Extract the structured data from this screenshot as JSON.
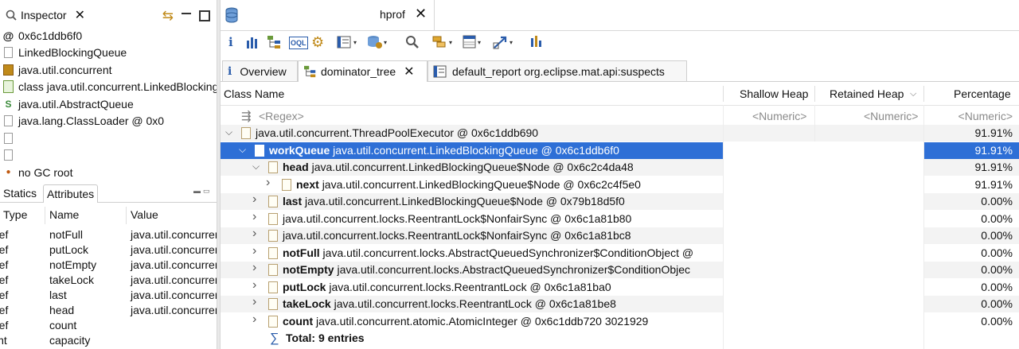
{
  "left_panel": {
    "tab_title": "Inspector",
    "lines": [
      {
        "icon": "at-sign-icon",
        "text": "0x6c1ddb6f0"
      },
      {
        "icon": "document-icon",
        "text": "LinkedBlockingQueue"
      },
      {
        "icon": "package-icon",
        "text": "java.util.concurrent"
      },
      {
        "icon": "class-icon",
        "text": "class java.util.concurrent.LinkedBlockingQueue"
      },
      {
        "icon": "superclass-icon",
        "text": "java.util.AbstractQueue"
      },
      {
        "icon": "classloader-icon",
        "text": "java.lang.ClassLoader @ 0x0"
      },
      {
        "icon": "document-icon",
        "text": ""
      },
      {
        "icon": "document-icon",
        "text": ""
      },
      {
        "icon": "gc-root-icon",
        "text": "no GC root"
      }
    ],
    "tabs": [
      "Statics",
      "Attributes"
    ],
    "attributes": {
      "headers": [
        "Type",
        "Name",
        "Value"
      ],
      "rows": [
        {
          "type": "ref",
          "name": "notFull",
          "value": "java.util.concurrent"
        },
        {
          "type": "ref",
          "name": "putLock",
          "value": "java.util.concurrent"
        },
        {
          "type": "ref",
          "name": "notEmpty",
          "value": "java.util.concurrent"
        },
        {
          "type": "ref",
          "name": "takeLock",
          "value": "java.util.concurrent"
        },
        {
          "type": "ref",
          "name": "last",
          "value": "java.util.concurrent"
        },
        {
          "type": "ref",
          "name": "head",
          "value": "java.util.concurrent"
        },
        {
          "type": "ref",
          "name": "count",
          "value": ""
        },
        {
          "type": "int",
          "name": "capacity",
          "value": ""
        }
      ]
    }
  },
  "editor": {
    "tab_title": "hprof",
    "toolbar_icons": [
      "info-icon",
      "histogram-icon",
      "dominator-tree-icon",
      "oql-icon",
      "thread-icon",
      "query-browser-icon",
      "heap-dump-overview-icon",
      "search-icon",
      "group-by-icon",
      "calculate-icon",
      "export-icon",
      "pie-chart-icon"
    ],
    "sub_tabs": [
      {
        "label": "Overview",
        "icon": "info-icon"
      },
      {
        "label": "dominator_tree",
        "icon": "dominator-tree-icon"
      },
      {
        "label": "default_report org.eclipse.mat.api:suspects",
        "icon": "report-icon"
      }
    ],
    "columns": [
      "Class Name",
      "Shallow Heap",
      "Retained Heap",
      "Percentage"
    ],
    "filter_row": {
      "class": "<Regex>",
      "shallow": "<Numeric>",
      "retained": "<Numeric>",
      "percentage": "<Numeric>"
    },
    "rows": [
      {
        "indent": 0,
        "twisty": "expanded",
        "bold": "",
        "text": "java.util.concurrent.ThreadPoolExecutor @ 0x6c1ddb690",
        "pct": "91.91%",
        "selected": false
      },
      {
        "indent": 1,
        "twisty": "expanded",
        "bold": "workQueue",
        "text": "java.util.concurrent.LinkedBlockingQueue @ 0x6c1ddb6f0",
        "pct": "91.91%",
        "selected": true
      },
      {
        "indent": 2,
        "twisty": "expanded",
        "bold": "head",
        "text": "java.util.concurrent.LinkedBlockingQueue$Node @ 0x6c2c4da48",
        "pct": "91.91%",
        "selected": false
      },
      {
        "indent": 3,
        "twisty": "collapsed",
        "bold": "next",
        "text": "java.util.concurrent.LinkedBlockingQueue$Node @ 0x6c2c4f5e0",
        "pct": "91.91%",
        "selected": false
      },
      {
        "indent": 2,
        "twisty": "collapsed",
        "bold": "last",
        "text": "java.util.concurrent.LinkedBlockingQueue$Node @ 0x79b18d5f0",
        "pct": "0.00%",
        "selected": false
      },
      {
        "indent": 2,
        "twisty": "collapsed",
        "bold": "",
        "text": "java.util.concurrent.locks.ReentrantLock$NonfairSync @ 0x6c1a81b80",
        "pct": "0.00%",
        "selected": false
      },
      {
        "indent": 2,
        "twisty": "collapsed",
        "bold": "",
        "text": "java.util.concurrent.locks.ReentrantLock$NonfairSync @ 0x6c1a81bc8",
        "pct": "0.00%",
        "selected": false
      },
      {
        "indent": 2,
        "twisty": "collapsed",
        "bold": "notFull",
        "text": "java.util.concurrent.locks.AbstractQueuedSynchronizer$ConditionObject @",
        "pct": "0.00%",
        "selected": false
      },
      {
        "indent": 2,
        "twisty": "collapsed",
        "bold": "notEmpty",
        "text": "java.util.concurrent.locks.AbstractQueuedSynchronizer$ConditionObjec",
        "pct": "0.00%",
        "selected": false
      },
      {
        "indent": 2,
        "twisty": "collapsed",
        "bold": "putLock",
        "text": "java.util.concurrent.locks.ReentrantLock @ 0x6c1a81ba0",
        "pct": "0.00%",
        "selected": false
      },
      {
        "indent": 2,
        "twisty": "collapsed",
        "bold": "takeLock",
        "text": "java.util.concurrent.locks.ReentrantLock @ 0x6c1a81be8",
        "pct": "0.00%",
        "selected": false
      },
      {
        "indent": 2,
        "twisty": "collapsed",
        "bold": "count",
        "text": "java.util.concurrent.atomic.AtomicInteger @ 0x6c1ddb720  3021929",
        "pct": "0.00%",
        "selected": false
      }
    ],
    "total_label": "Total: 9 entries"
  },
  "colors": {
    "selection": "#2e6fd6",
    "stripe": "#f3f3f3"
  }
}
